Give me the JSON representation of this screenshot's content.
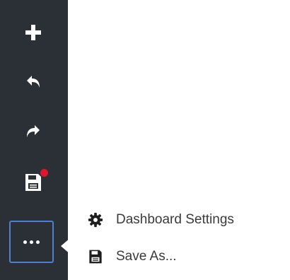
{
  "toolbar": {
    "buttons": [
      {
        "icon": "plus-icon"
      },
      {
        "icon": "undo-icon"
      },
      {
        "icon": "redo-icon"
      },
      {
        "icon": "save-icon",
        "has_unsaved_badge": true
      },
      {
        "icon": "more-icon",
        "active": true
      }
    ],
    "badge_color": "#e0162b",
    "background": "#2b2f36",
    "active_border": "#4f7fd0"
  },
  "menu": {
    "items": [
      {
        "label": "Dashboard Settings",
        "icon": "gear-icon"
      },
      {
        "label": "Save As...",
        "icon": "save-icon"
      }
    ]
  }
}
